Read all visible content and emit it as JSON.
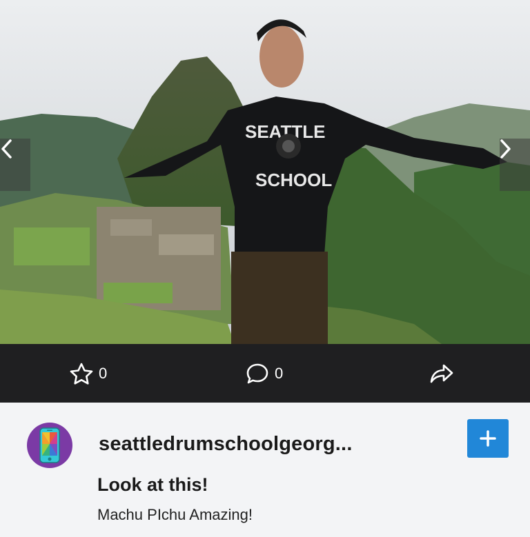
{
  "photo": {
    "icon": "photo-image",
    "prev_icon": "chevron-left-icon",
    "next_icon": "chevron-right-icon"
  },
  "actions": {
    "star_icon": "star-icon",
    "star_count": "0",
    "comment_icon": "speech-bubble-icon",
    "comment_count": "0",
    "share_icon": "share-arrow-icon"
  },
  "post": {
    "avatar_icon": "phone-avatar-icon",
    "username": "seattledrumschoolgeorg...",
    "follow_label": "+",
    "title": "Look at this!",
    "caption": "Machu PIchu Amazing!"
  },
  "colors": {
    "action_bar": "#1f1f21",
    "follow_button": "#2187d8",
    "avatar_bg": "#7b3aa5",
    "page_bg": "#f3f4f6"
  }
}
